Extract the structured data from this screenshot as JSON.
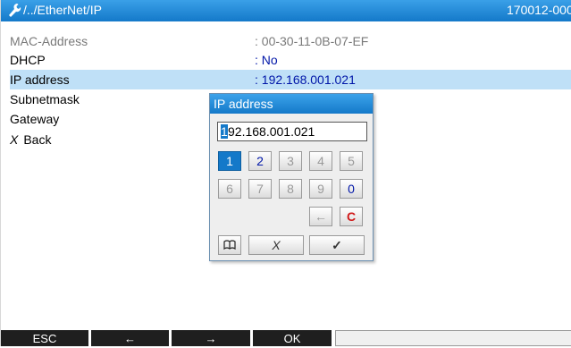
{
  "titlebar": {
    "path": "/../EtherNet/IP",
    "serial": "170012-000",
    "icon": "wrench-icon"
  },
  "rows": [
    {
      "label": "MAC-Address",
      "value": ": 00-30-11-0B-07-EF",
      "state": "disabled"
    },
    {
      "label": "DHCP",
      "value": ": No",
      "state": "normal"
    },
    {
      "label": "IP address",
      "value": ": 192.168.001.021",
      "state": "selected"
    },
    {
      "label": "Subnetmask",
      "value": "",
      "state": "normal"
    },
    {
      "label": "Gateway",
      "value": "",
      "state": "normal"
    },
    {
      "label": "Back",
      "value": "",
      "state": "normal",
      "prefix": "X"
    }
  ],
  "dialog": {
    "title": "IP address",
    "field_cursor_char": "1",
    "field_rest": "92.168.001.021",
    "keys_row1": [
      "1",
      "2",
      "3",
      "4",
      "5"
    ],
    "keys_row2": [
      "6",
      "7",
      "8",
      "9",
      "0"
    ],
    "backspace": "←",
    "clear": "C",
    "book": "📖",
    "cancel": "X",
    "confirm": "✓"
  },
  "softkeys": [
    "ESC",
    "←",
    "→",
    "OK",
    ""
  ],
  "colors": {
    "accent": "#1479c9",
    "selected_row": "#bfe0f7",
    "value_blue": "#0016a8",
    "clear_red": "#d01818"
  }
}
